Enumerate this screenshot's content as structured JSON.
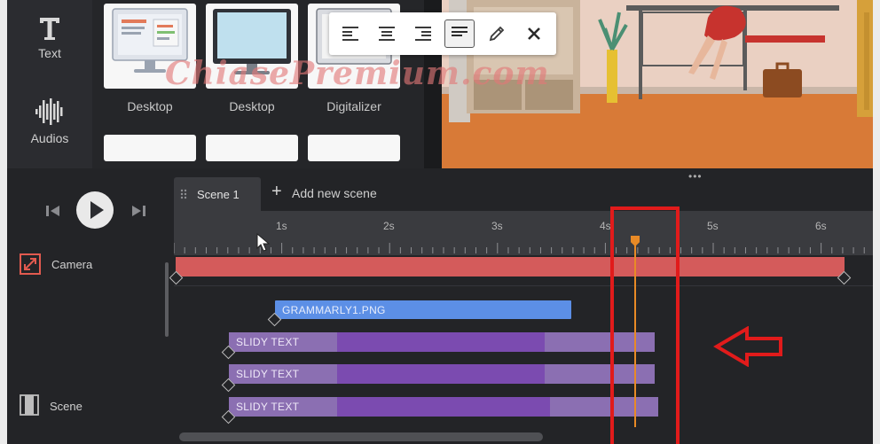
{
  "watermark": "ChiasePremium.com",
  "sidebar": {
    "tools": [
      {
        "label": "Text",
        "icon": "text-icon"
      },
      {
        "label": "Audios",
        "icon": "audio-waveform-icon"
      }
    ]
  },
  "assets": {
    "cards": [
      {
        "label": "Desktop"
      },
      {
        "label": "Desktop"
      },
      {
        "label": "Digitalizer"
      }
    ]
  },
  "text_toolbar": {
    "buttons": [
      {
        "name": "align-left-button",
        "icon": "align-left-icon"
      },
      {
        "name": "align-center-button",
        "icon": "align-center-icon"
      },
      {
        "name": "align-right-button",
        "icon": "align-right-icon"
      },
      {
        "name": "align-justify-button",
        "icon": "align-justify-icon",
        "active": true
      },
      {
        "name": "edit-button",
        "icon": "pencil-icon"
      },
      {
        "name": "close-button",
        "icon": "close-icon"
      }
    ]
  },
  "playback": {
    "play_icon": "play-icon",
    "prev_icon": "step-back-icon",
    "next_icon": "step-forward-icon"
  },
  "scenes": {
    "active_tab": "Scene 1",
    "add_label": "Add new scene"
  },
  "ruler": {
    "labels": [
      "1s",
      "2s",
      "3s",
      "4s",
      "5s",
      "6s"
    ]
  },
  "tracks": {
    "camera": {
      "label": "Camera"
    },
    "scene": {
      "label": "Scene"
    }
  },
  "clips": [
    {
      "label": "GRAMMARLY1.PNG",
      "type": "image"
    },
    {
      "label": "SLIDY TEXT",
      "type": "text"
    },
    {
      "label": "SLIDY TEXT",
      "type": "text"
    },
    {
      "label": "SLIDY TEXT",
      "type": "text"
    }
  ],
  "colors": {
    "camera_track": "#d45b5b",
    "image_clip": "#5c8fe6",
    "text_clip": "#7b4bb0",
    "playhead": "#e88a26",
    "annotation": "#e11b1b"
  }
}
